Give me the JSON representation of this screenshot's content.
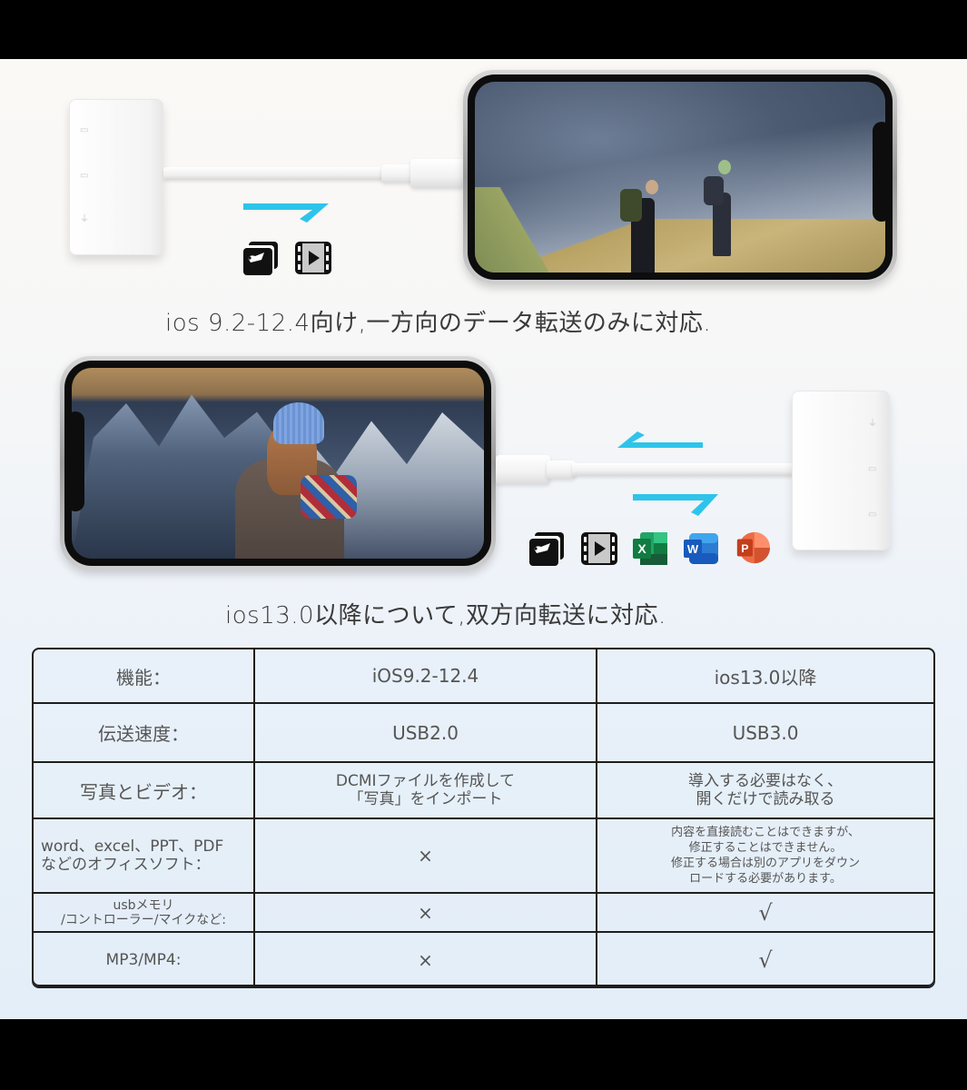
{
  "top_section": {
    "caption": "ios 9.2-12.4向け,一方向のデータ転送のみに対応.",
    "arrow_direction": "one-way (adapter to phone)",
    "file_icons": [
      "photos-icon",
      "video-icon"
    ],
    "adapter_ports": [
      "sd-card-port-icon",
      "tf-card-port-icon",
      "usb-port-icon"
    ]
  },
  "middle_section": {
    "caption": "ios13.0以降について,双方向転送に対応.",
    "arrow_direction": "two-way",
    "file_icons": [
      "photos-icon",
      "video-icon",
      "excel-icon",
      "word-icon",
      "powerpoint-icon"
    ],
    "adapter_ports": [
      "usb-port-icon",
      "sd-card-port-icon",
      "tf-card-port-icon"
    ],
    "app_letters": {
      "excel": "X",
      "word": "W",
      "powerpoint": "P"
    }
  },
  "colors": {
    "arrow": "#2ec4ea",
    "excel": "#1f7a45",
    "word": "#2b5cc4",
    "powerpoint": "#e4582b",
    "table_border": "#1e1e1e",
    "text": "#555555"
  },
  "table": {
    "header": [
      "機能：",
      "iOS9.2-12.4",
      "ios13.0以降"
    ],
    "rows": [
      {
        "feature": "伝送速度：",
        "old": "USB2.0",
        "new": "USB3.0"
      },
      {
        "feature": "写真とビデオ：",
        "old": [
          "DCMIファイルを作成して",
          "「写真」をインポート"
        ],
        "new": [
          "導入する必要はなく、",
          "開くだけで読み取る"
        ]
      },
      {
        "feature": [
          "word、excel、PPT、PDF",
          "などのオフィスソフト："
        ],
        "old": "×",
        "new": [
          "内容を直接読むことはできますが、",
          "修正することはできません。",
          "修正する場合は別のアプリをダウン",
          "ロードする必要があります。"
        ]
      },
      {
        "feature": [
          "usbメモリ",
          "/コントローラー/マイクなど:"
        ],
        "old": "×",
        "new": "√"
      },
      {
        "feature": "MP3/MP4:",
        "old": "×",
        "new": "√"
      }
    ]
  }
}
